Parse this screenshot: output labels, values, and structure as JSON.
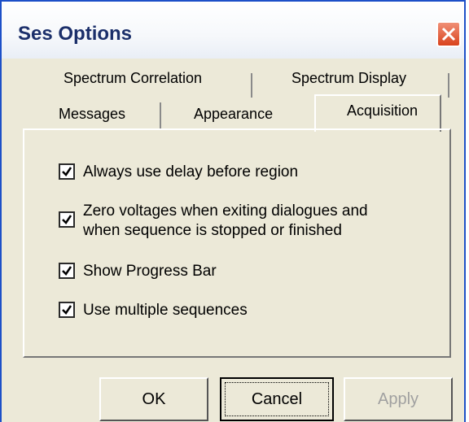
{
  "window": {
    "title": "Ses Options"
  },
  "tabs": {
    "row1": [
      {
        "label": "Spectrum Correlation"
      },
      {
        "label": "Spectrum Display"
      }
    ],
    "row2": [
      {
        "label": "Messages"
      },
      {
        "label": "Appearance"
      },
      {
        "label": "Acquisition",
        "active": true
      }
    ]
  },
  "options": [
    {
      "label": "Always use delay before region",
      "checked": true
    },
    {
      "label_line1": "Zero voltages when exiting dialogues and",
      "label_line2": "when sequence is stopped or finished",
      "checked": true
    },
    {
      "label": "Show Progress Bar",
      "checked": true
    },
    {
      "label": "Use multiple sequences",
      "checked": true
    }
  ],
  "buttons": {
    "ok": "OK",
    "cancel": "Cancel",
    "apply": "Apply"
  },
  "icons": {
    "close": "close-icon",
    "check": "checkmark-icon"
  },
  "colors": {
    "title_text": "#1b2f6a",
    "close_button": "#d9431d",
    "window_border": "#1d50c8",
    "face": "#ece9d8"
  }
}
